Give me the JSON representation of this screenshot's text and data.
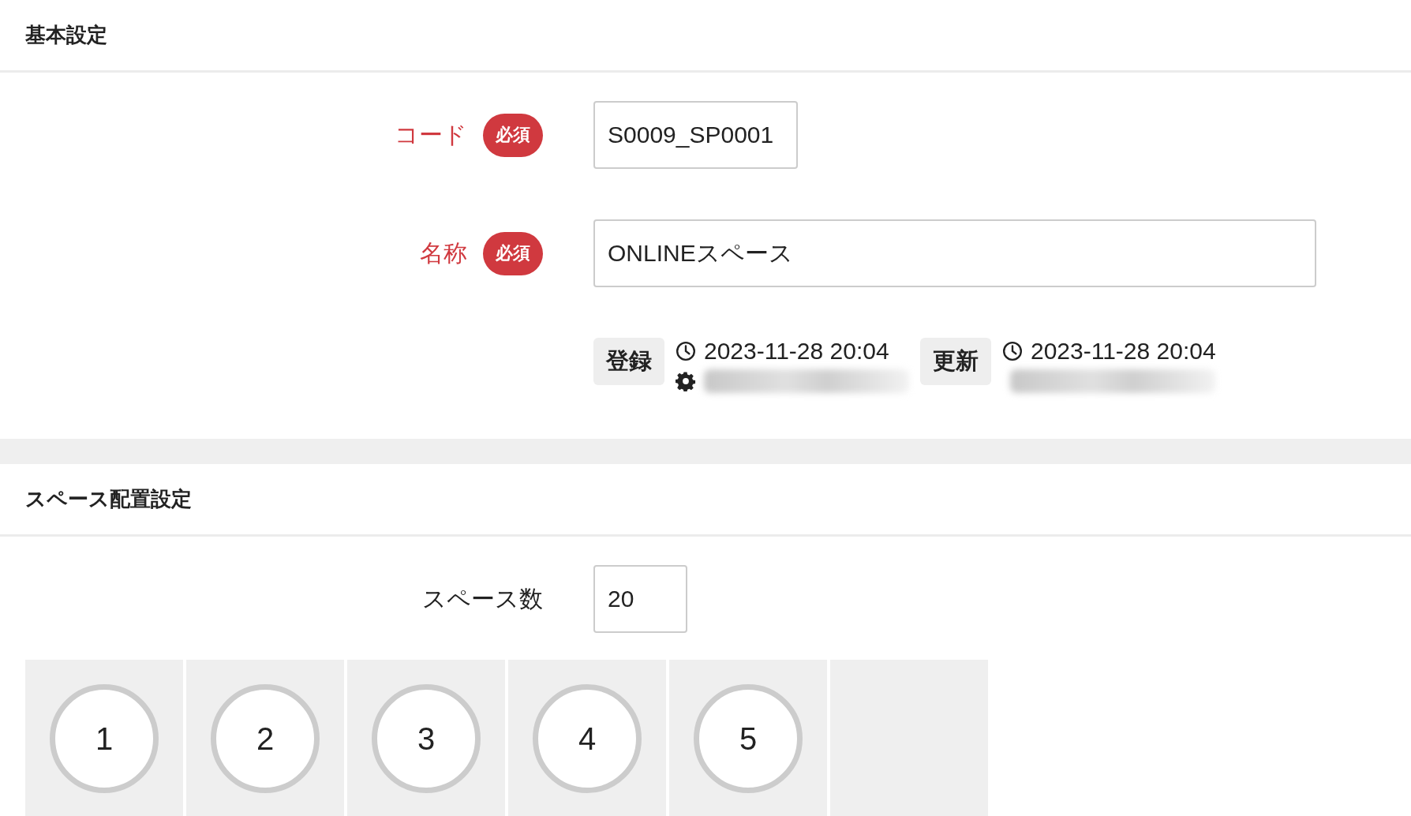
{
  "sections": [
    {
      "title": "基本設定",
      "fields": [
        {
          "label": "コード",
          "required": true,
          "badge": "必須",
          "value": "S0009_SP0001"
        },
        {
          "label": "名称",
          "required": true,
          "badge": "必須",
          "value": "ONLINEスペース"
        }
      ],
      "meta": [
        {
          "badge": "登録",
          "time": "2023-11-28 20:04",
          "user_icon": true
        },
        {
          "badge": "更新",
          "time": "2023-11-28 20:04",
          "user_icon": false
        }
      ]
    },
    {
      "title": "スペース配置設定",
      "fields": [
        {
          "label": "スペース数",
          "required": false,
          "value": "20"
        }
      ],
      "spaces": [
        {
          "kind": "space",
          "label": "1"
        },
        {
          "kind": "space",
          "label": "2"
        },
        {
          "kind": "space",
          "label": "3"
        },
        {
          "kind": "space",
          "label": "4"
        },
        {
          "kind": "space",
          "label": "5"
        },
        {
          "kind": "empty"
        }
      ]
    }
  ]
}
